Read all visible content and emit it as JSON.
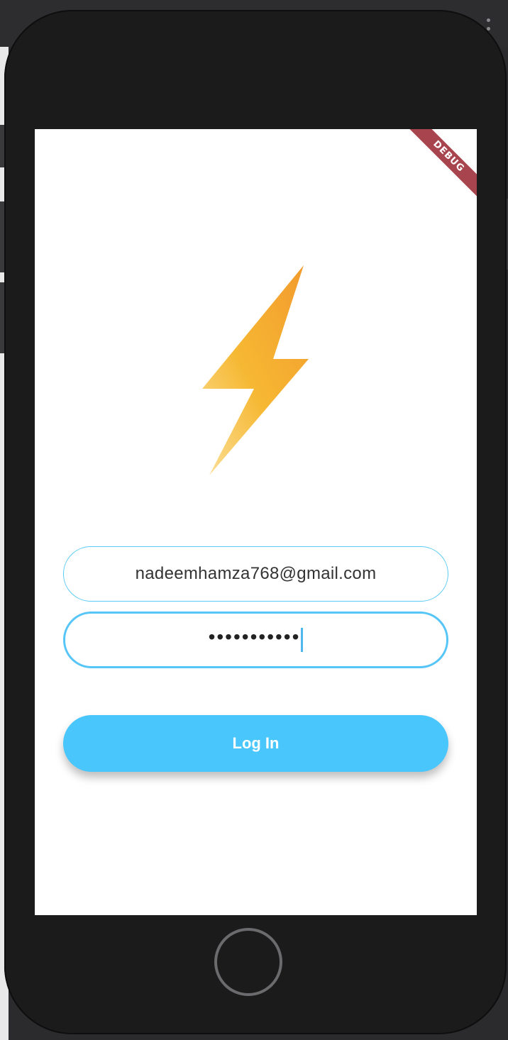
{
  "debug_banner": "DEBUG",
  "login_form": {
    "email_value": "nadeemhamza768@gmail.com",
    "password_masked": "•••••••••••",
    "login_button_label": "Log In"
  },
  "colors": {
    "accent": "#49c6fb",
    "field_border": "#5ccbf5",
    "logo_gradient_top": "#f29a2e",
    "logo_gradient_bottom": "#f9d77a",
    "debug_banner": "#a8444d"
  },
  "icons": {
    "logo": "lightning-bolt-icon",
    "device_home": "home-button"
  }
}
